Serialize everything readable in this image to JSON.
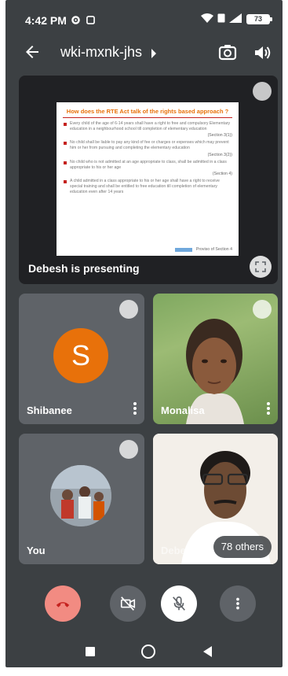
{
  "status_bar": {
    "time": "4:42 PM",
    "battery": "73",
    "icons": [
      "settings-icon",
      "sync-icon",
      "wifi-icon",
      "sim-icon",
      "signal-icon",
      "battery-icon"
    ]
  },
  "top_bar": {
    "meeting_code": "wki-mxnk-jhs",
    "icons": [
      "back-arrow-icon",
      "caret-right-icon",
      "camera-switch-icon",
      "speaker-icon"
    ]
  },
  "presentation": {
    "label": "Debesh is presenting",
    "slide": {
      "title": "How does the RTE Act talk of the rights based approach ?",
      "items": [
        "Every child of the age of 6-14 years shall have a right to free and compulsory Elementary education in a neighbourhood school till completion of elementary education",
        "No child shall be liable to pay any kind of fee or charges or expenses which may prevent him or her from pursuing and completing the elementary education",
        "No child who is not admitted at an age appropriate to class, shall be admitted in a class appropriate to his or her age",
        "A child admitted in a class appropriate to his or her age shall have a right to receive special training and shall be entitled to free education till completion of elementary education even after 14 years"
      ],
      "citations": [
        "(Section 3(1))",
        "(Section 3(2))",
        "(Section 4)"
      ],
      "footer": "Proviso of Section 4"
    }
  },
  "participants": [
    {
      "name": "Shibanee",
      "initial": "S",
      "avatar_color": "#e8710a"
    },
    {
      "name": "Monalisa"
    },
    {
      "name": "You"
    },
    {
      "name": "Debesh",
      "others_label": "78 others"
    }
  ],
  "controls": [
    "end-call-icon",
    "camera-off-icon",
    "mic-off-icon",
    "more-options-icon"
  ],
  "nav": [
    "recents-icon",
    "home-icon",
    "back-icon"
  ],
  "colors": {
    "background": "#3c4043",
    "end_call": "#f28b82",
    "avatar": "#e8710a",
    "slide_title": "#e8710a"
  }
}
